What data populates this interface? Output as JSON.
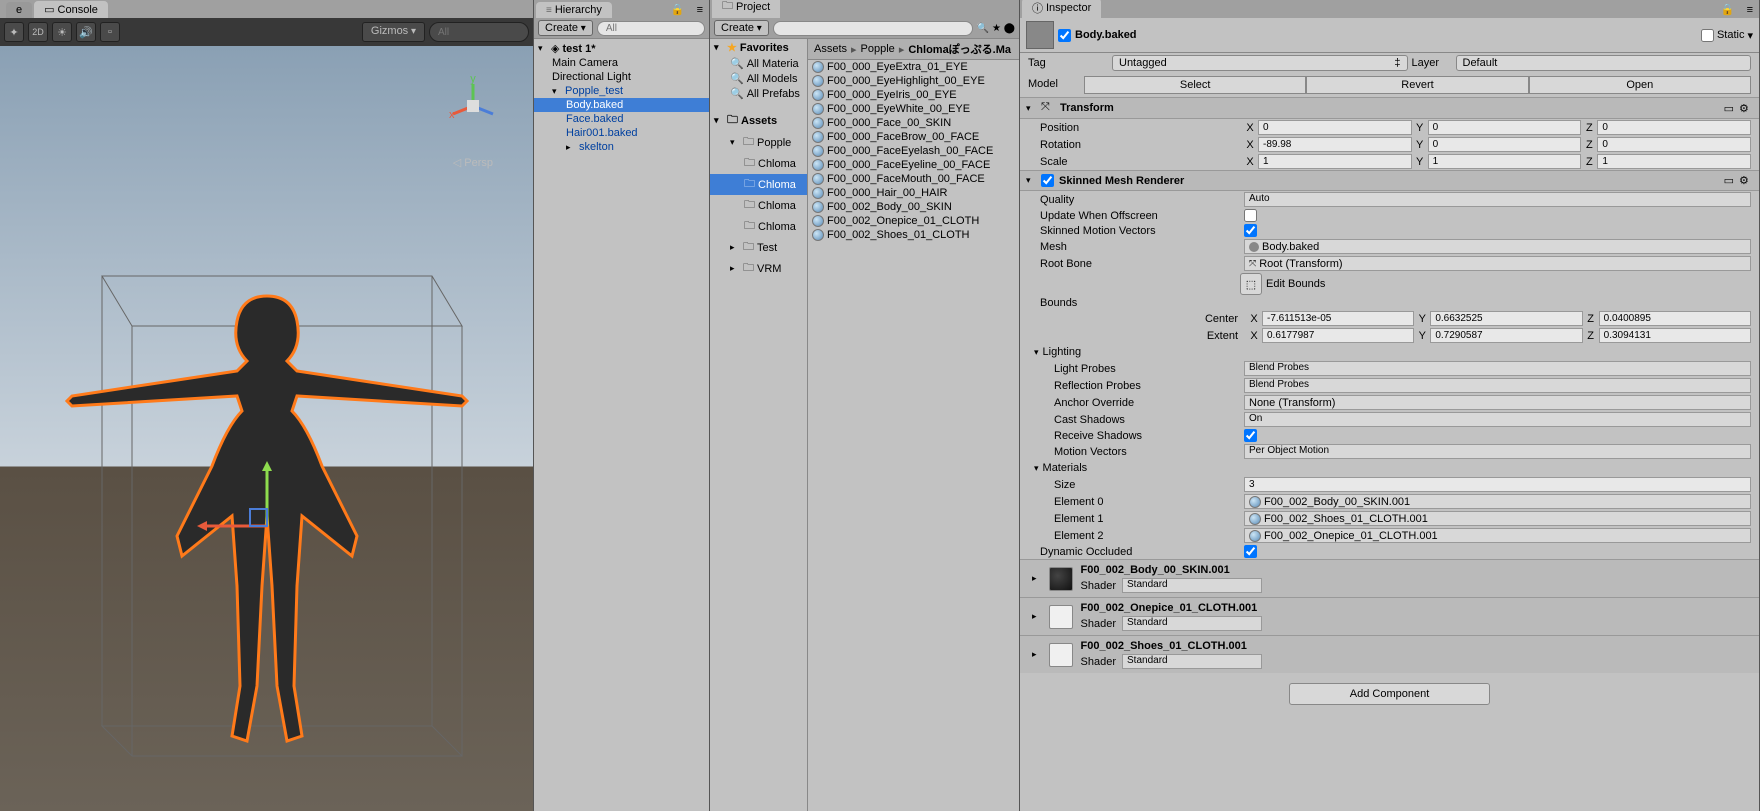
{
  "tabs": {
    "console": "Console",
    "hierarchy": "Hierarchy",
    "project": "Project",
    "inspector": "Inspector"
  },
  "scene_toolbar": {
    "gizmos": "Gizmos",
    "all": "All",
    "persp": "Persp"
  },
  "hierarchy": {
    "create": "Create",
    "search_all": "All",
    "scene": "test 1*",
    "items": [
      "Main Camera",
      "Directional Light",
      "Popple_test",
      "Body.baked",
      "Face.baked",
      "Hair001.baked",
      "skelton"
    ]
  },
  "project": {
    "create": "Create",
    "favorites": "Favorites",
    "fav_items": [
      "All Materia",
      "All Models",
      "All Prefabs"
    ],
    "assets_label": "Assets",
    "folders": [
      "Popple",
      "Chloma",
      "Chloma",
      "Chloma",
      "Chloma",
      "Test",
      "VRM"
    ],
    "breadcrumb": [
      "Assets",
      "Popple",
      "Chlomaぽっぷる.Ma"
    ],
    "materials": [
      "F00_000_EyeExtra_01_EYE",
      "F00_000_EyeHighlight_00_EYE",
      "F00_000_EyeIris_00_EYE",
      "F00_000_EyeWhite_00_EYE",
      "F00_000_Face_00_SKIN",
      "F00_000_FaceBrow_00_FACE",
      "F00_000_FaceEyelash_00_FACE",
      "F00_000_FaceEyeline_00_FACE",
      "F00_000_FaceMouth_00_FACE",
      "F00_000_Hair_00_HAIR",
      "F00_002_Body_00_SKIN",
      "F00_002_Onepice_01_CLOTH",
      "F00_002_Shoes_01_CLOTH"
    ]
  },
  "inspector": {
    "object_name": "Body.baked",
    "static_label": "Static",
    "tag_label": "Tag",
    "tag_value": "Untagged",
    "layer_label": "Layer",
    "layer_value": "Default",
    "model_label": "Model",
    "model_buttons": [
      "Select",
      "Revert",
      "Open"
    ],
    "transform": {
      "title": "Transform",
      "position_label": "Position",
      "rotation_label": "Rotation",
      "scale_label": "Scale",
      "position": {
        "x": "0",
        "y": "0",
        "z": "0"
      },
      "rotation": {
        "x": "-89.98",
        "y": "0",
        "z": "0"
      },
      "scale": {
        "x": "1",
        "y": "1",
        "z": "1"
      }
    },
    "smr": {
      "title": "Skinned Mesh Renderer",
      "quality_label": "Quality",
      "quality_value": "Auto",
      "update_offscreen_label": "Update When Offscreen",
      "motion_vectors_label": "Skinned Motion Vectors",
      "mesh_label": "Mesh",
      "mesh_value": "Body.baked",
      "root_bone_label": "Root Bone",
      "root_bone_value": "Root (Transform)",
      "edit_bounds": "Edit Bounds",
      "bounds_label": "Bounds",
      "center_label": "Center",
      "extent_label": "Extent",
      "center": {
        "x": "-7.611513e-05",
        "y": "0.6632525",
        "z": "0.0400895"
      },
      "extent": {
        "x": "0.6177987",
        "y": "0.7290587",
        "z": "0.3094131"
      },
      "lighting_label": "Lighting",
      "light_probes_label": "Light Probes",
      "light_probes_value": "Blend Probes",
      "refl_probes_label": "Reflection Probes",
      "refl_probes_value": "Blend Probes",
      "anchor_label": "Anchor Override",
      "anchor_value": "None (Transform)",
      "cast_shadows_label": "Cast Shadows",
      "cast_shadows_value": "On",
      "recv_shadows_label": "Receive Shadows",
      "mv_label": "Motion Vectors",
      "mv_value": "Per Object Motion",
      "materials_label": "Materials",
      "size_label": "Size",
      "size_value": "3",
      "elements": [
        {
          "label": "Element 0",
          "value": "F00_002_Body_00_SKIN.001"
        },
        {
          "label": "Element 1",
          "value": "F00_002_Shoes_01_CLOTH.001"
        },
        {
          "label": "Element 2",
          "value": "F00_002_Onepice_01_CLOTH.001"
        }
      ],
      "dyn_occ_label": "Dynamic Occluded"
    },
    "material_cards": [
      {
        "name": "F00_002_Body_00_SKIN.001",
        "shader": "Standard"
      },
      {
        "name": "F00_002_Onepice_01_CLOTH.001",
        "shader": "Standard"
      },
      {
        "name": "F00_002_Shoes_01_CLOTH.001",
        "shader": "Standard"
      }
    ],
    "shader_label": "Shader",
    "add_component": "Add Component"
  }
}
